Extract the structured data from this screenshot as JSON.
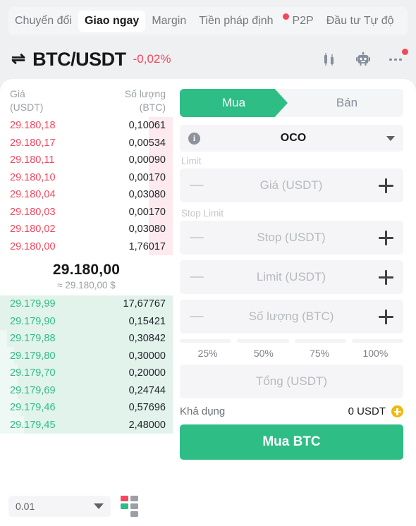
{
  "nav": {
    "tabs": [
      {
        "label": "Chuyển đổi",
        "active": false,
        "dot": false
      },
      {
        "label": "Giao ngay",
        "active": true,
        "dot": false
      },
      {
        "label": "Margin",
        "active": false,
        "dot": false
      },
      {
        "label": "Tiền pháp định",
        "active": false,
        "dot": false
      },
      {
        "label": "P2P",
        "active": false,
        "dot": true
      },
      {
        "label": "Đầu tư Tự độ",
        "active": false,
        "dot": false
      }
    ]
  },
  "header": {
    "swap_icon": "⇌",
    "pair": "BTC/USDT",
    "change_pct": "-0,02%",
    "change_color": "#f6465d",
    "icons": [
      "candlestick-chart-icon",
      "trading-bot-icon",
      "more-options-icon"
    ]
  },
  "orderbook": {
    "col_price": "Giá",
    "col_price_unit": "(USDT)",
    "col_qty": "Số lượng",
    "col_qty_unit": "(BTC)",
    "ask_color": "#f6465d",
    "bid_color": "#2ebd85",
    "asks": [
      {
        "price": "29.180,18",
        "qty": "0,10061",
        "depth": 14
      },
      {
        "price": "29.180,17",
        "qty": "0,00534",
        "depth": 14
      },
      {
        "price": "29.180,11",
        "qty": "0,00090",
        "depth": 14
      },
      {
        "price": "29.180,10",
        "qty": "0,00170",
        "depth": 14
      },
      {
        "price": "29.180,04",
        "qty": "0,03080",
        "depth": 14
      },
      {
        "price": "29.180,03",
        "qty": "0,00170",
        "depth": 14
      },
      {
        "price": "29.180,02",
        "qty": "0,03080",
        "depth": 14
      },
      {
        "price": "29.180,00",
        "qty": "1,76017",
        "depth": 14
      }
    ],
    "mid_price": "29.180,00",
    "mid_usd": "≈ 29.180,00 $",
    "bids": [
      {
        "price": "29.179,99",
        "qty": "17,67767",
        "depth": 100
      },
      {
        "price": "29.179,90",
        "qty": "0,15421",
        "depth": 100
      },
      {
        "price": "29.179,88",
        "qty": "0,30842",
        "depth": 96
      },
      {
        "price": "29.179,80",
        "qty": "0,30000",
        "depth": 92
      },
      {
        "price": "29.179,70",
        "qty": "0,20000",
        "depth": 90
      },
      {
        "price": "29.179,69",
        "qty": "0,24744",
        "depth": 90
      },
      {
        "price": "29.179,46",
        "qty": "0,57696",
        "depth": 88
      },
      {
        "price": "29.179,45",
        "qty": "2,48000",
        "depth": 86
      }
    ],
    "tick_size": "0.01",
    "layout_toggle_icon": "orderbook-layout-icon"
  },
  "form": {
    "buy_tab": "Mua",
    "sell_tab": "Bán",
    "buy_color": "#2ebd85",
    "order_type": "OCO",
    "info_icon": "info-icon",
    "dropdown_icon": "chevron-down-icon",
    "limit_label": "Limit",
    "price_placeholder": "Giá (USDT)",
    "stop_limit_label": "Stop Limit",
    "stop_placeholder": "Stop (USDT)",
    "limit_placeholder": "Limit (USDT)",
    "amount_placeholder": "Số lượng (BTC)",
    "percents": [
      "25%",
      "50%",
      "75%",
      "100%"
    ],
    "total_placeholder": "Tổng (USDT)",
    "available_label": "Khả dụng",
    "available_value": "0 USDT",
    "add_funds_icon": "plus-circle-icon",
    "add_funds_color": "#f0b90b",
    "submit_label": "Mua BTC"
  }
}
